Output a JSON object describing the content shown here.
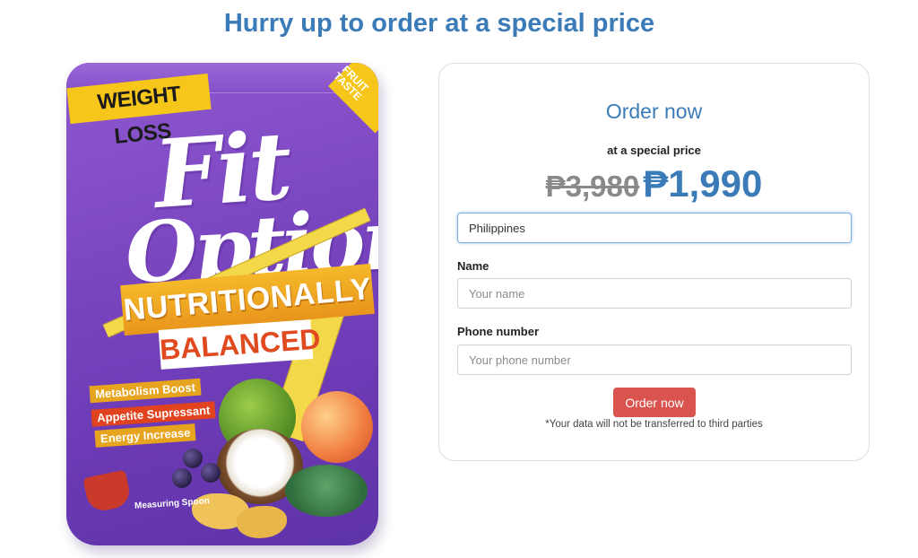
{
  "headline": "Hurry up to order at a special price",
  "product": {
    "tag_weight": "WEIGHT LOSS",
    "tag_fruit": "FRUIT TASTE",
    "brand_line1": "Fit",
    "brand_line2": "Option",
    "banner_line1": "NUTRITIONALLY",
    "banner_line2": "BALANCED",
    "benefits": [
      "Metabolism Boost",
      "Appetite Supressant",
      "Energy Increase"
    ],
    "spoon_label": "Measuring Spoon"
  },
  "order": {
    "title": "Order now",
    "subtitle": "at a special price",
    "old_price": "₱3,980",
    "new_price": "₱1,990",
    "country_value": "Philippines",
    "name_label": "Name",
    "name_placeholder": "Your name",
    "phone_label": "Phone number",
    "phone_placeholder": "Your phone number",
    "submit_label": "Order now",
    "disclaimer": "*Your data will not be transferred to third parties"
  },
  "colors": {
    "accent_blue": "#3a7bb8",
    "button_red": "#d9534f",
    "pouch_purple": "#7a46c0"
  }
}
